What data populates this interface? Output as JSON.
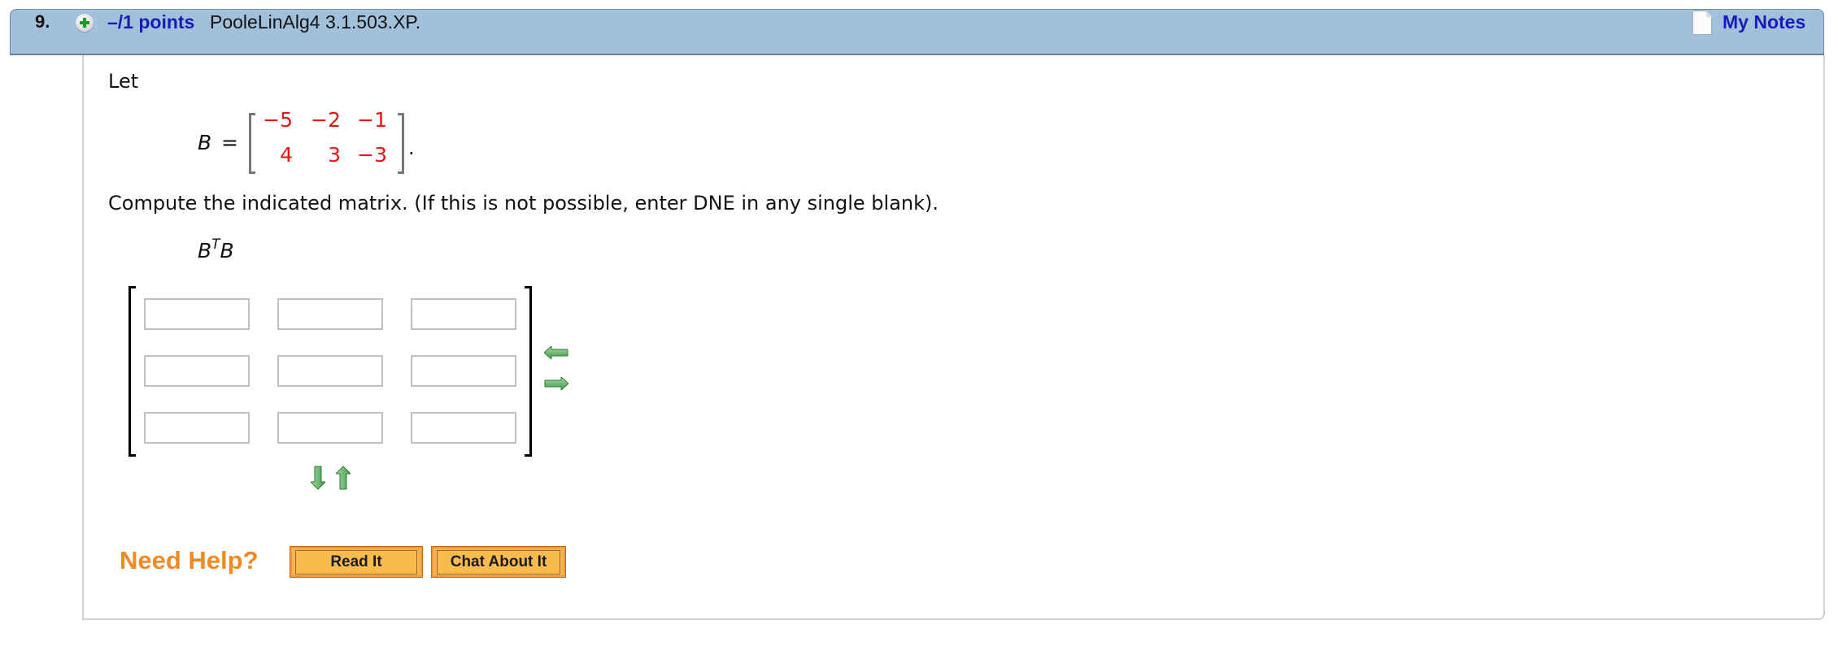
{
  "header": {
    "question_number": "9.",
    "points_label": "–/1 points",
    "question_id": "PooleLinAlg4 3.1.503.XP.",
    "my_notes_label": "My Notes",
    "icons": {
      "expand": "plus-circle-icon",
      "notes": "notes-page-icon"
    },
    "bg_color": "#a0c0dc",
    "link_color": "#1a1ab8"
  },
  "problem": {
    "intro": "Let",
    "matrix_name": "B",
    "equals": "=",
    "matrix_B": [
      [
        "−5",
        "−2",
        "−1"
      ],
      [
        "4",
        "3",
        "−3"
      ]
    ],
    "matrix_value_color": "#ee1111",
    "period": ".",
    "instruction": "Compute the indicated matrix. (If this is not possible, enter DNE in any single blank).",
    "expression_base": "B",
    "expression_sup": "T",
    "expression_tail": "B"
  },
  "answer_matrix": {
    "rows": 3,
    "cols": 3,
    "values": [
      [
        "",
        "",
        ""
      ],
      [
        "",
        "",
        ""
      ],
      [
        "",
        "",
        ""
      ]
    ],
    "controls": {
      "remove_column": "arrow-left-icon",
      "add_column": "arrow-right-icon",
      "add_row": "arrow-down-icon",
      "remove_row": "arrow-up-icon"
    }
  },
  "help": {
    "label": "Need Help?",
    "read_it": "Read It",
    "chat_about_it": "Chat About It",
    "label_color": "#f08a24"
  }
}
